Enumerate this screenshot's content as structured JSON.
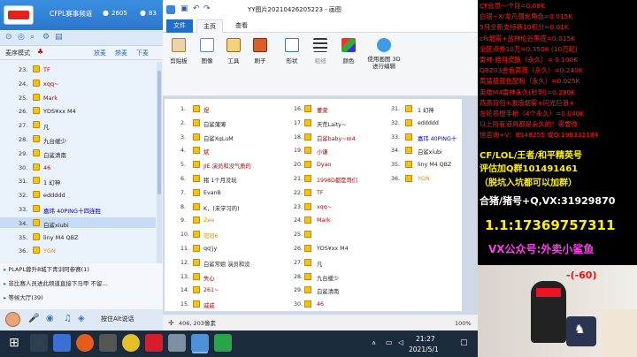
{
  "left_panel": {
    "channel_name": "CFPL赛事频道",
    "count1": "2605",
    "count2": "83",
    "mode": "麦序模式",
    "tabs": [
      "放麦",
      "禁麦",
      "下麦"
    ],
    "rows": [
      {
        "n": "23.",
        "m": "TF",
        "c": "#b00000"
      },
      {
        "n": "24.",
        "m": "xqq~",
        "c": "#b00000"
      },
      {
        "n": "25.",
        "m": "Mark",
        "c": "#b00000"
      },
      {
        "n": "26.",
        "m": "YDS¥xx M4",
        "c": "#222222"
      },
      {
        "n": "27.",
        "m": "凡",
        "c": "#222222"
      },
      {
        "n": "28.",
        "m": "九台缓少",
        "c": "#222222"
      },
      {
        "n": "29.",
        "m": "白鲨清南",
        "c": "#222222"
      },
      {
        "n": "30.",
        "m": "46",
        "c": "#b00000"
      },
      {
        "n": "31.",
        "m": "1 幻神",
        "c": "#222222"
      },
      {
        "n": "32.",
        "m": "eddddd",
        "c": "#222222"
      },
      {
        "n": "33.",
        "m": "嘉玮 40PING十四连胜",
        "c": "#0000cc"
      },
      {
        "n": "34.",
        "m": "白鲨xiubi",
        "c": "#222222"
      },
      {
        "n": "35.",
        "m": "liny M4 QBZ",
        "c": "#222222"
      },
      {
        "n": "36.",
        "m": "YGN",
        "c": "#e08a00"
      }
    ],
    "messages": [
      "PLAPL蓉升8城下青训阿参赛(1)",
      "非比赛人员进此频道直接下马甲 不留...",
      "等候大厅(39)"
    ],
    "voice_hint": "按住Alt说话"
  },
  "paint": {
    "title": "YY图片20210426205223 - 画图",
    "tabs": [
      "文件",
      "主页",
      "查看"
    ],
    "tools": [
      "剪贴板",
      "图像",
      "工具",
      "刷子",
      "形状",
      "粗细",
      "颜色",
      "使用画图 3D 进行编辑"
    ],
    "status_coords": "406, 203像素",
    "zoom": "100%",
    "col1": [
      {
        "n": "1.",
        "m": "煜",
        "c": "#b00000"
      },
      {
        "n": "2.",
        "m": "白鲨蒲薄",
        "c": "#222222"
      },
      {
        "n": "3.",
        "m": "白鲨XqLuM",
        "c": "#222222"
      },
      {
        "n": "4.",
        "m": "斌",
        "c": "#b00000"
      },
      {
        "n": "5.",
        "m": "JIE 演员和没气质的",
        "c": "#b00000"
      },
      {
        "n": "6.",
        "m": "猪 1个月没玩",
        "c": "#222222"
      },
      {
        "n": "7.",
        "m": "EvanB",
        "c": "#222222"
      },
      {
        "n": "8.",
        "m": "K，(未学习的)",
        "c": "#222222"
      },
      {
        "n": "9.",
        "m": "Zee",
        "c": "#e08a00"
      },
      {
        "n": "10.",
        "m": "冠冠6",
        "c": "#e08a00"
      },
      {
        "n": "11.",
        "m": "qq'jy",
        "c": "#222222"
      },
      {
        "n": "12.",
        "m": "白鲨常姐 演员和没",
        "c": "#222222"
      },
      {
        "n": "13.",
        "m": "失心",
        "c": "#b00000"
      },
      {
        "n": "14.",
        "m": "261~",
        "c": "#b00000"
      },
      {
        "n": "15.",
        "m": "戚戚",
        "c": "#b00000"
      }
    ],
    "col2": [
      {
        "n": "16.",
        "m": "董萱",
        "c": "#b00000"
      },
      {
        "n": "17.",
        "m": "天荒Laity~",
        "c": "#222222"
      },
      {
        "n": "18.",
        "m": "白鲨baby~m4",
        "c": "#b00000"
      },
      {
        "n": "19.",
        "m": "小谦",
        "c": "#b00000"
      },
      {
        "n": "20.",
        "m": "Dyao",
        "c": "#b00000"
      },
      {
        "n": "21.",
        "m": "1998D都是哥们",
        "c": "#b00000"
      },
      {
        "n": "22.",
        "m": "TF",
        "c": "#b00000"
      },
      {
        "n": "23.",
        "m": "xqq~",
        "c": "#b00000"
      },
      {
        "n": "24.",
        "m": "Mark",
        "c": "#b00000"
      },
      {
        "n": "25.",
        "m": "",
        "c": "#222222"
      },
      {
        "n": "26.",
        "m": "YDS¥xx M4",
        "c": "#222222"
      },
      {
        "n": "27.",
        "m": "凡",
        "c": "#222222"
      },
      {
        "n": "28.",
        "m": "九台缓少",
        "c": "#222222"
      },
      {
        "n": "29.",
        "m": "白鲨清南",
        "c": "#222222"
      },
      {
        "n": "30.",
        "m": "46",
        "c": "#b00000"
      }
    ],
    "col3": [
      {
        "n": "31.",
        "m": "1 幻神",
        "c": "#222222"
      },
      {
        "n": "32.",
        "m": "eddddd",
        "c": "#222222"
      },
      {
        "n": "33.",
        "m": "嘉玮 40PING十",
        "c": "#0000cc"
      },
      {
        "n": "34.",
        "m": "白鲨xiubi",
        "c": "#222222"
      },
      {
        "n": "35.",
        "m": "liny M4 QBZ",
        "c": "#222222"
      },
      {
        "n": "36.",
        "m": "YGN",
        "c": "#e08a00"
      }
    ]
  },
  "overlay": {
    "red_lines": [
      "CF会员一个月=0.08K",
      "白银~X/龙凡强化角色=0.015K",
      "5月全新支持赛10积分=0.01K",
      "cfs烟雾+丛林伦谷黑底=0.015K",
      "全区点券10万=0.350K (10万起)",
      "雷神-皓月皮肤（永久）= 0.100K",
      "QBZ03金色蔷薇（永久）=0.240K",
      "黄猛基蓝色配粉（永久）=0.025K",
      "英雄M4雷神永久(秒到)=0.280K",
      "燕燕背包+激浪烟雾+闪光巨浪+",
      "左轮恶棍手枪（4个永久）=0.040K",
      "以上所有道具都是永久的！需要微",
      "信咨询+V：BS48255   或Q:198332184"
    ],
    "promo1": "CF/LOL/王者/和平精英号",
    "promo2": "评估加Q群101491461",
    "promo3": "（脱坑入坑都可以加群）",
    "promo4": "合猪/猪号+Q,VX:31929870",
    "phone": "1.1:17369757311",
    "vx": "VX公众号:外卖小鲨鱼",
    "counter": "-(-60)"
  },
  "taskbar": {
    "time": "21:27",
    "date": "2021/5/1"
  }
}
